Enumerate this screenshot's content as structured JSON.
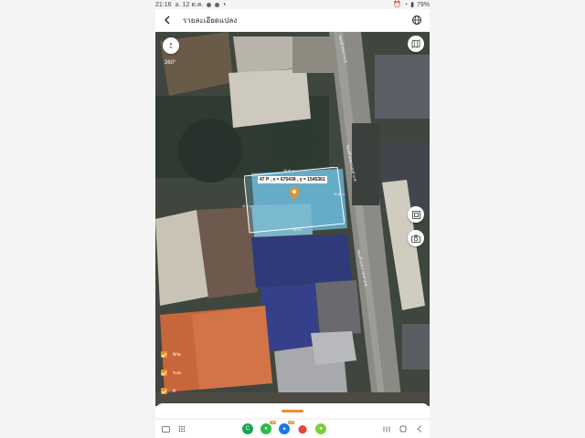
{
  "status_bar": {
    "time": "21:16",
    "date": "อ. 12 ต.ค.",
    "battery": "79%"
  },
  "header": {
    "title": "รายละเอียดแปลง"
  },
  "map": {
    "compass_letter": "N",
    "view_label": "360°",
    "parcel_label": "47 P , x = 675439 , y = 1545361",
    "edge_top": "16.41 ม.",
    "edge_right": "11.56 ม.",
    "edge_bottom": "16.0 ม.",
    "edge_left": "11.4 ม.",
    "road_label_top": "ซอยห้วยขวาง 6",
    "road_label_mid": "ซอยห้วยขวางกลาง 6",
    "road_label_low": "ซอยห้วยขวางกลาง 6",
    "accent_color": "#e8912a"
  },
  "layers": [
    {
      "label": "พิกัด"
    },
    {
      "label": "ระยะ"
    },
    {
      "label": "ดี"
    }
  ],
  "navbar": {
    "badge_1": "99",
    "badge_2": "99"
  }
}
